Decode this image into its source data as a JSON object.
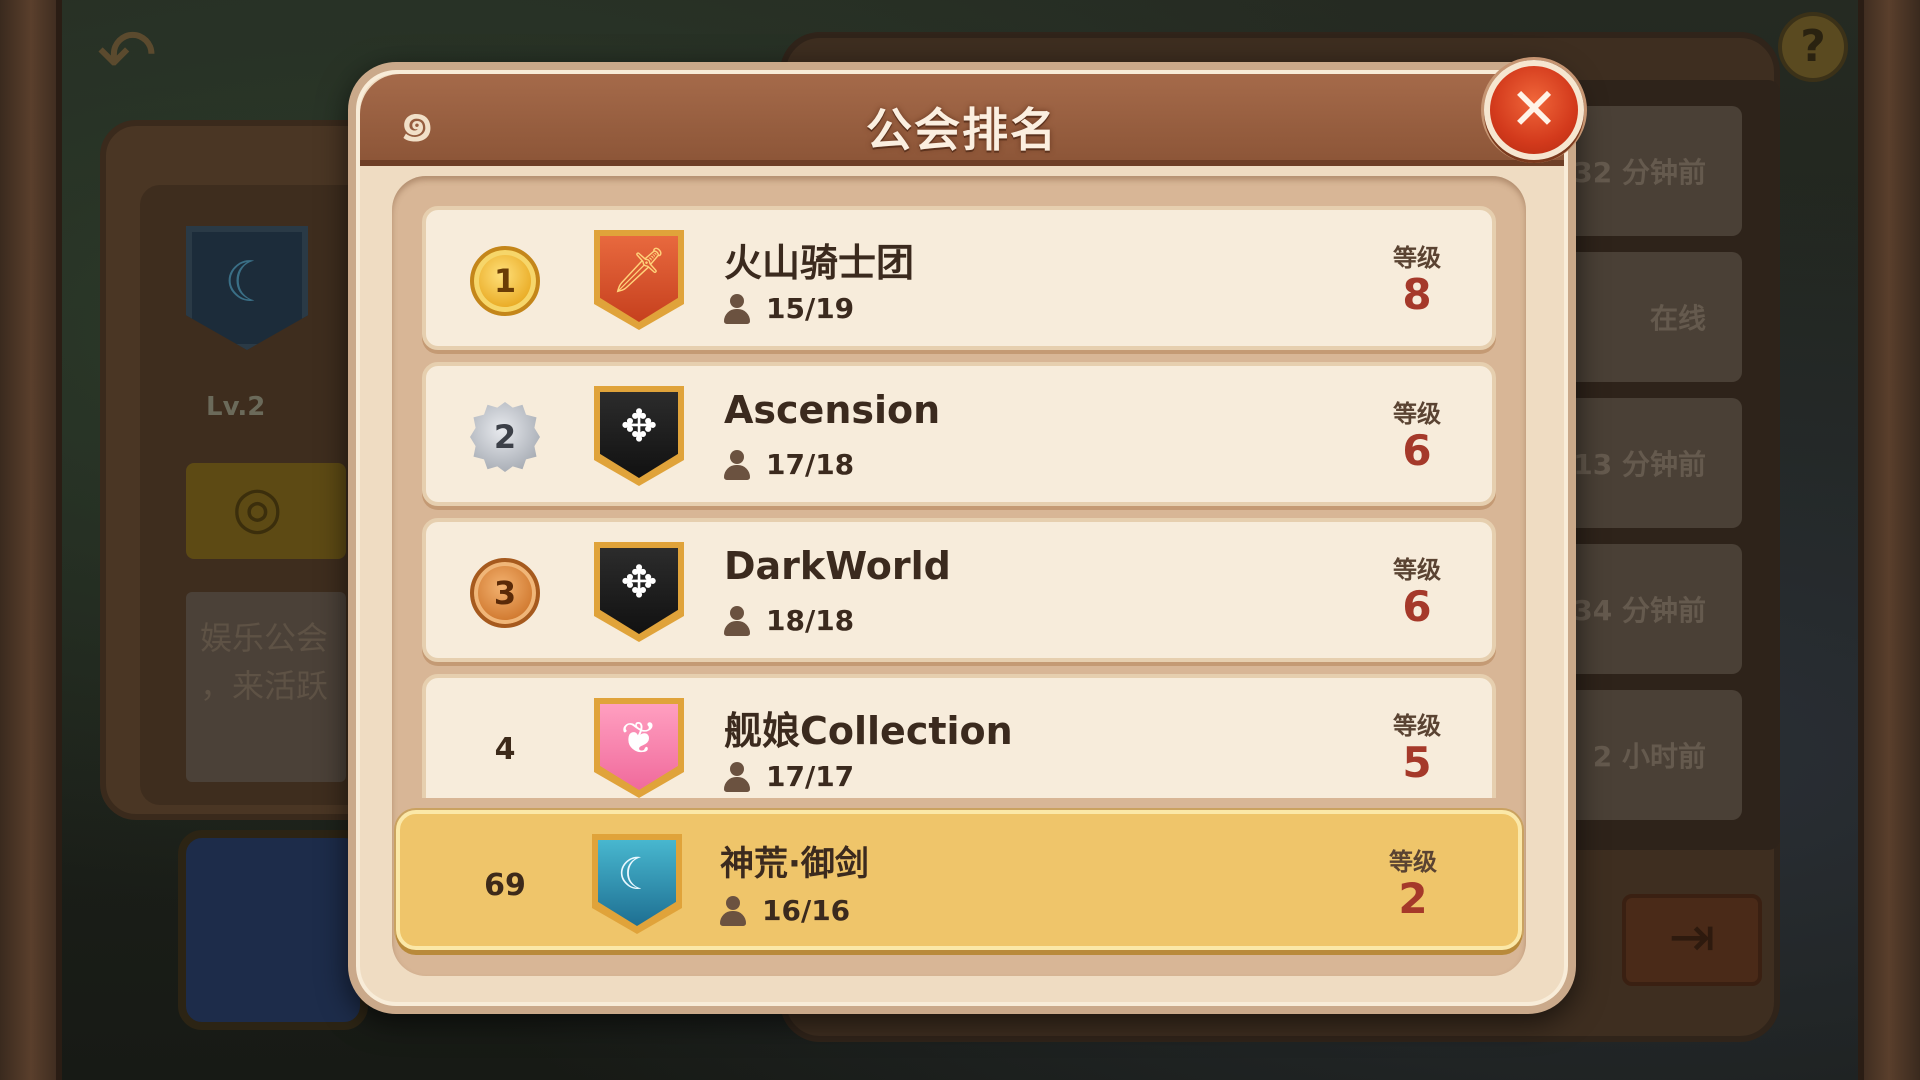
{
  "background": {
    "left_panel": {
      "level": "Lv.2",
      "motto": "娱乐公会\n，来活跃"
    },
    "right_panel": {
      "items": [
        "32 分钟前",
        "在线",
        "13 分钟前",
        "34 分钟前",
        "2 小时前"
      ]
    }
  },
  "modal": {
    "title": "公会排名",
    "level_label": "等级",
    "rows": [
      {
        "rank": "1",
        "rank_style": "gold",
        "crest": "sword-crest-icon",
        "name": "火山骑士团",
        "members": "15/19",
        "level": "8"
      },
      {
        "rank": "2",
        "rank_style": "silver",
        "crest": "diamond-cross-crest-icon",
        "name": "Ascension",
        "members": "17/18",
        "level": "6"
      },
      {
        "rank": "3",
        "rank_style": "bronze",
        "crest": "diamond-cross-crest-icon",
        "name": "DarkWorld",
        "members": "18/18",
        "level": "6"
      },
      {
        "rank": "4",
        "rank_style": "plain",
        "crest": "butterfly-crest-icon",
        "name": "舰娘Collection",
        "members": "17/17",
        "level": "5"
      }
    ],
    "my_guild": {
      "rank": "69",
      "crest": "moon-crest-icon",
      "name": "神荒·御剑",
      "members": "16/16",
      "level": "2"
    }
  },
  "colors": {
    "header": "#9b603f",
    "panel": "#efdcc2",
    "highlight_row": "#efc56a",
    "level_value": "#a5392a",
    "close_button": "#d33a1c"
  }
}
